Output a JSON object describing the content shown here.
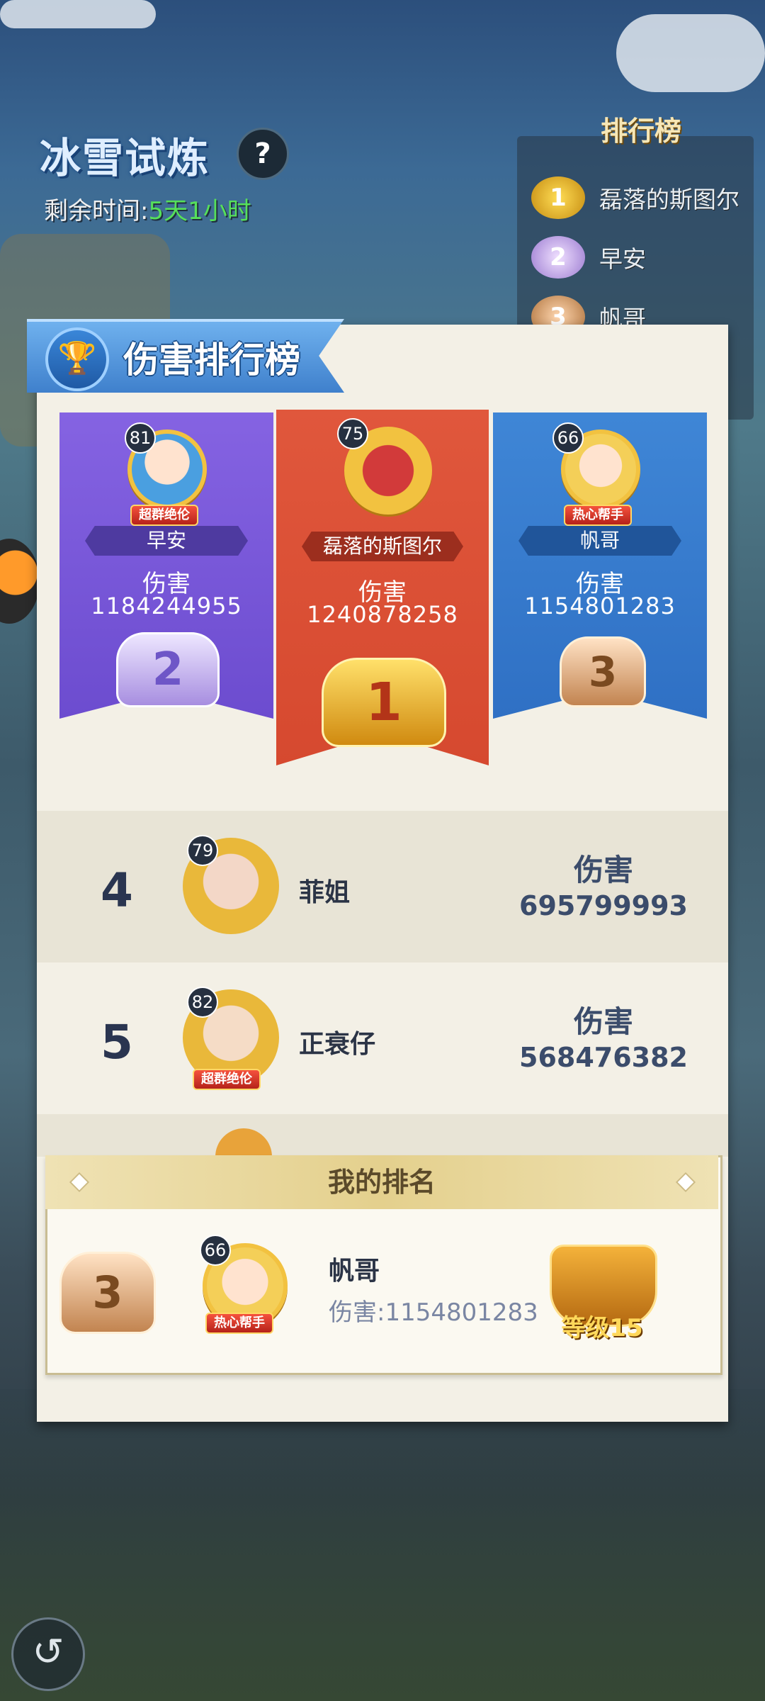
{
  "event": {
    "title": "冰雪试炼",
    "help_icon": "?",
    "remaining_label": "剩余时间:",
    "remaining_value": "5天1小时"
  },
  "mini_rank": {
    "title": "排行榜",
    "items": [
      {
        "badge": "1",
        "name": "磊落的斯图尔"
      },
      {
        "badge": "2",
        "name": "早安"
      },
      {
        "badge": "3",
        "name": "帆哥"
      }
    ]
  },
  "panel": {
    "title": "伤害排行榜",
    "podium": [
      {
        "rank": "2",
        "level": "81",
        "name": "早安",
        "damage_label": "伤害",
        "damage": "1184244955",
        "tag": "超群绝伦"
      },
      {
        "rank": "1",
        "level": "75",
        "name": "磊落的斯图尔",
        "damage_label": "伤害",
        "damage": "1240878258"
      },
      {
        "rank": "3",
        "level": "66",
        "name": "帆哥",
        "damage_label": "伤害",
        "damage": "1154801283",
        "tag": "热心帮手"
      }
    ],
    "rows": [
      {
        "rank": "4",
        "level": "79",
        "name": "菲姐",
        "damage_label": "伤害",
        "damage": "695799993"
      },
      {
        "rank": "5",
        "level": "82",
        "name": "正衰仔",
        "damage_label": "伤害",
        "damage": "568476382",
        "tag": "超群绝伦"
      }
    ]
  },
  "my_rank": {
    "title": "我的排名",
    "rank": "3",
    "level": "66",
    "name": "帆哥",
    "damage_text": "伤害:1154801283",
    "tag": "热心帮手",
    "level_badge": "等级15"
  }
}
